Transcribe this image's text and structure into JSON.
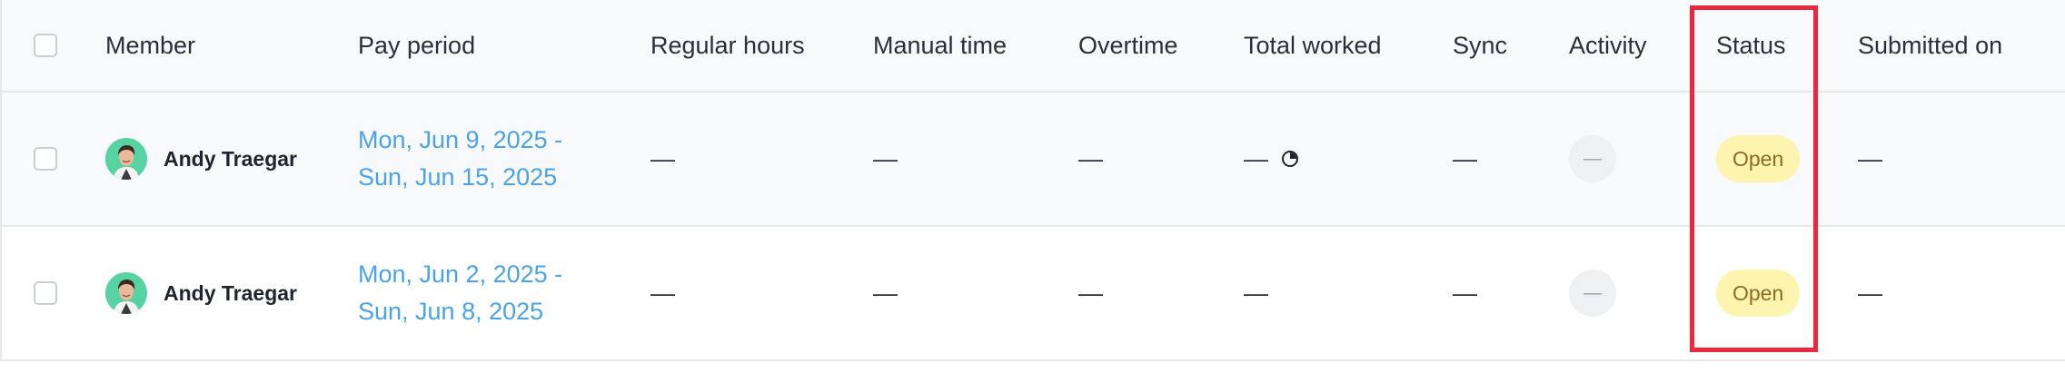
{
  "header": {
    "member": "Member",
    "pay_period": "Pay period",
    "regular_hours": "Regular hours",
    "manual_time": "Manual time",
    "overtime": "Overtime",
    "total_worked": "Total worked",
    "sync": "Sync",
    "activity": "Activity",
    "status": "Status",
    "submitted_on": "Submitted on"
  },
  "rows": [
    {
      "member": "Andy Traegar",
      "period_line1": "Mon, Jun 9, 2025 -",
      "period_line2": "Sun, Jun 15, 2025",
      "regular_hours": "—",
      "manual_time": "—",
      "overtime": "—",
      "total_worked": "—",
      "total_worked_icon": "timer-icon",
      "sync": "—",
      "activity": "—",
      "status": "Open",
      "submitted_on": "—"
    },
    {
      "member": "Andy Traegar",
      "period_line1": "Mon, Jun 2, 2025 -",
      "period_line2": "Sun, Jun 8, 2025",
      "regular_hours": "—",
      "manual_time": "—",
      "overtime": "—",
      "total_worked": "—",
      "sync": "—",
      "activity": "—",
      "status": "Open",
      "submitted_on": "—"
    }
  ],
  "colors": {
    "link": "#4aa3e8",
    "status_open_bg": "#fdf4b0",
    "status_open_text": "#8a6d1f",
    "highlight": "#e8283c",
    "avatar_bg": "#57d3a3"
  }
}
